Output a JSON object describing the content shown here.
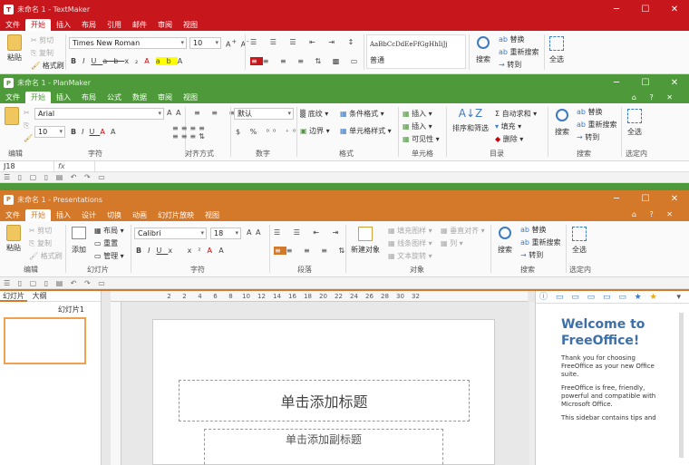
{
  "textmaker": {
    "title": "未命名 1 - TextMaker",
    "app_letter": "T",
    "menu": [
      "文件",
      "开始",
      "插入",
      "布局",
      "引用",
      "邮件",
      "审阅",
      "视图"
    ],
    "active_menu": "开始",
    "paste": "粘贴",
    "cut": "剪切",
    "copy": "复制",
    "format_painter": "格式刷",
    "font": "Times New Roman",
    "size": "10",
    "style_preview": "AaBbCcDdEeFfGgHhIiJj",
    "style_name": "普通",
    "search": "搜索",
    "replace": "替换",
    "replace_again": "重新搜索",
    "goto": "转到",
    "select_all": "全选",
    "color": "#c8161d"
  },
  "planmaker": {
    "title": "未命名 1 - PlanMaker",
    "app_letter": "P",
    "menu": [
      "文件",
      "开始",
      "插入",
      "布局",
      "公式",
      "数据",
      "审阅",
      "视图"
    ],
    "active_menu": "开始",
    "font": "Arial",
    "size": "10",
    "number_format": "默认",
    "border_pattern": "底纹",
    "conditional_format": "条件格式",
    "borders": "边界",
    "cell_style": "单元格样式",
    "insert1": "插入",
    "insert2": "插入",
    "visible": "可见性",
    "sort_filter": "排序和筛选",
    "autosum": "自动求和",
    "fill": "填充",
    "delete": "删除",
    "search": "搜索",
    "replace": "替换",
    "replace_again": "重新搜索",
    "goto": "转到",
    "select_all": "全选",
    "groups": [
      "编辑",
      "字符",
      "对齐方式",
      "数字",
      "格式",
      "单元格",
      "目录",
      "搜索",
      "选定内"
    ],
    "cellref": "J18",
    "fx": "fx",
    "color": "#4e9a3a"
  },
  "presentations": {
    "title": "未命名 1 - Presentations",
    "app_letter": "P",
    "menu": [
      "文件",
      "开始",
      "插入",
      "设计",
      "切换",
      "动画",
      "幻灯片放映",
      "视图"
    ],
    "active_menu": "开始",
    "paste": "粘贴",
    "cut": "剪切",
    "copy": "复制",
    "format_painter": "格式刷",
    "add": "添加",
    "layout": "布局",
    "reset": "重置",
    "manage": "管理",
    "font": "Calibri",
    "size": "18",
    "new_object": "新建对象",
    "fill_pattern": "填充图样",
    "line_pattern": "线条图样",
    "text_rotate": "文本旋转",
    "v_align": "垂直对齐",
    "columns": "列",
    "search": "搜索",
    "replace": "替换",
    "replace_again": "重新搜索",
    "goto": "转到",
    "select_all": "全选",
    "groups": [
      "编辑",
      "幻灯片",
      "字符",
      "段落",
      "对象",
      "搜索",
      "选定内"
    ],
    "panel_tabs": [
      "幻灯片",
      "大纲"
    ],
    "slide_label": "幻灯片1",
    "ruler": [
      "2",
      "2",
      "4",
      "6",
      "8",
      "10",
      "12",
      "14",
      "16",
      "18",
      "20",
      "22",
      "24",
      "26",
      "28",
      "30",
      "32"
    ],
    "title_placeholder": "单击添加标题",
    "subtitle_placeholder": "单击添加副标题",
    "sidebar_heading": "Welcome to FreeOffice!",
    "sidebar_p1": "Thank you for choosing FreeOffice as your new Office suite.",
    "sidebar_p2": "FreeOffice is free, friendly, powerful and compatible with Microsoft Office.",
    "sidebar_p3": "This sidebar contains tips and",
    "color": "#d4782a"
  }
}
